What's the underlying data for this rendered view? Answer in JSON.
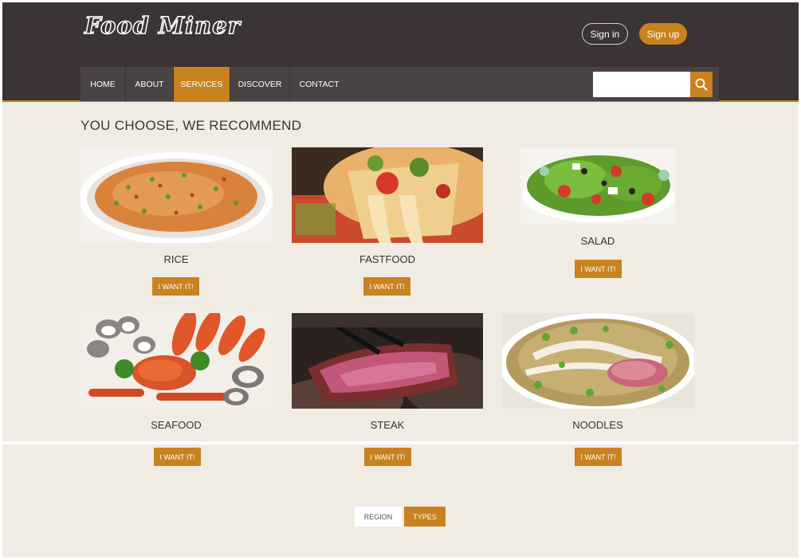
{
  "brand": {
    "logo": "Food Miner"
  },
  "auth": {
    "signin_label": "Sign in",
    "signup_label": "Sign up"
  },
  "nav": {
    "items": [
      {
        "label": "HOME"
      },
      {
        "label": "ABOUT"
      },
      {
        "label": "SERVICES",
        "active": true
      },
      {
        "label": "DISCOVER"
      },
      {
        "label": "CONTACT"
      }
    ],
    "search": {
      "placeholder": "",
      "icon": "search-icon"
    }
  },
  "main": {
    "title": "YOU CHOOSE, WE RECOMMEND",
    "foods": [
      {
        "name": "RICE",
        "button": "I WANT IT!",
        "image": "fried-rice-photo"
      },
      {
        "name": "FASTFOOD",
        "button": "I WANT IT!",
        "image": "pizza-photo"
      },
      {
        "name": "SALAD",
        "button": "I WANT IT!",
        "image": "salad-photo"
      },
      {
        "name": "SEAFOOD",
        "button": "I WANT IT!",
        "image": "seafood-platter-photo"
      },
      {
        "name": "STEAK",
        "button": "I WANT IT!",
        "image": "steak-photo"
      },
      {
        "name": "NOODLES",
        "button": "I WANT IT!",
        "image": "noodle-soup-photo"
      }
    ]
  },
  "filters": {
    "tabs": [
      {
        "label": "REGION"
      },
      {
        "label": "TYPES",
        "active": true
      }
    ]
  },
  "colors": {
    "accent": "#c8821f",
    "header": "#3c3434",
    "nav": "#4a4343",
    "background": "#f0ece4"
  }
}
